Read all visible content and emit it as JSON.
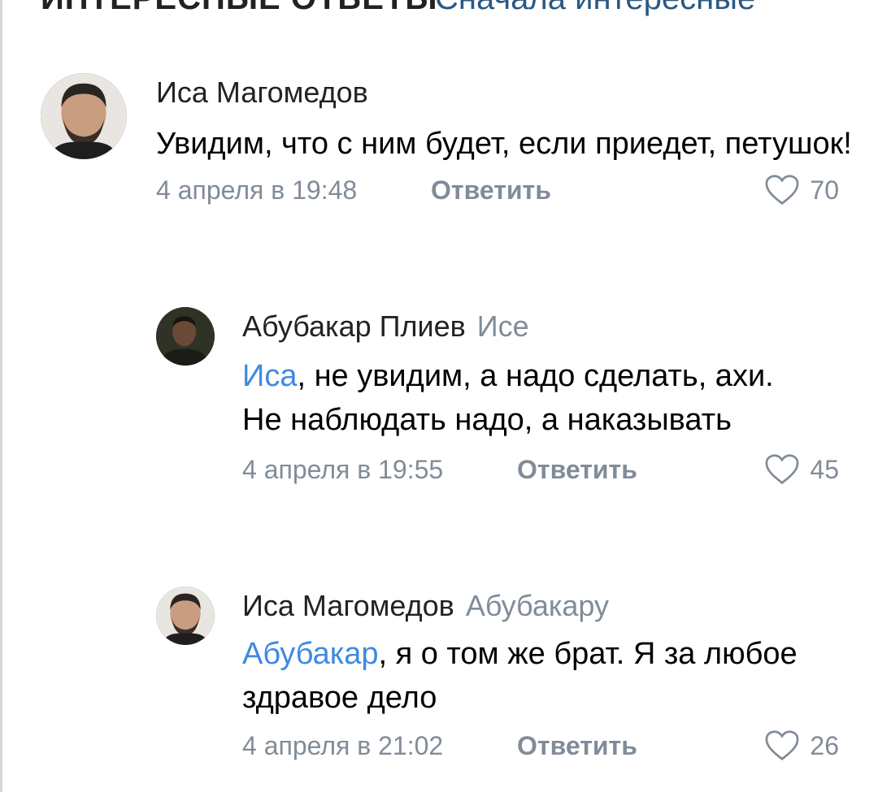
{
  "header": {
    "sort_label": "ИНТЕРЕСНЫЕ ОТВЕТЫ",
    "sort_value": "Сначала интересные"
  },
  "comments": [
    {
      "author": "Иса Магомедов",
      "reply_to": "",
      "mention": "",
      "text": "Увидим, что с ним будет, если приедет, петушок!",
      "date": "4 апреля в 19:48",
      "reply_label": "Ответить",
      "likes": "70"
    },
    {
      "author": "Абубакар Плиев",
      "reply_to": "Исе",
      "mention": "Иса",
      "text": ", не увидим, а надо сделать, ахи. Не наблюдать надо, а наказывать",
      "date": "4 апреля в 19:55",
      "reply_label": "Ответить",
      "likes": "45"
    },
    {
      "author": "Иса Магомедов",
      "reply_to": "Абубакару",
      "mention": "Абубакар",
      "text": ", я о том же брат. Я за любое здравое дело",
      "date": "4 апреля в 21:02",
      "reply_label": "Ответить",
      "likes": "26"
    }
  ],
  "icons": {
    "like": "heart-icon",
    "avatar": "user-photo"
  },
  "colors": {
    "link": "#3f8ae0",
    "secondary_text": "#818c99",
    "primary_text": "#000000"
  }
}
